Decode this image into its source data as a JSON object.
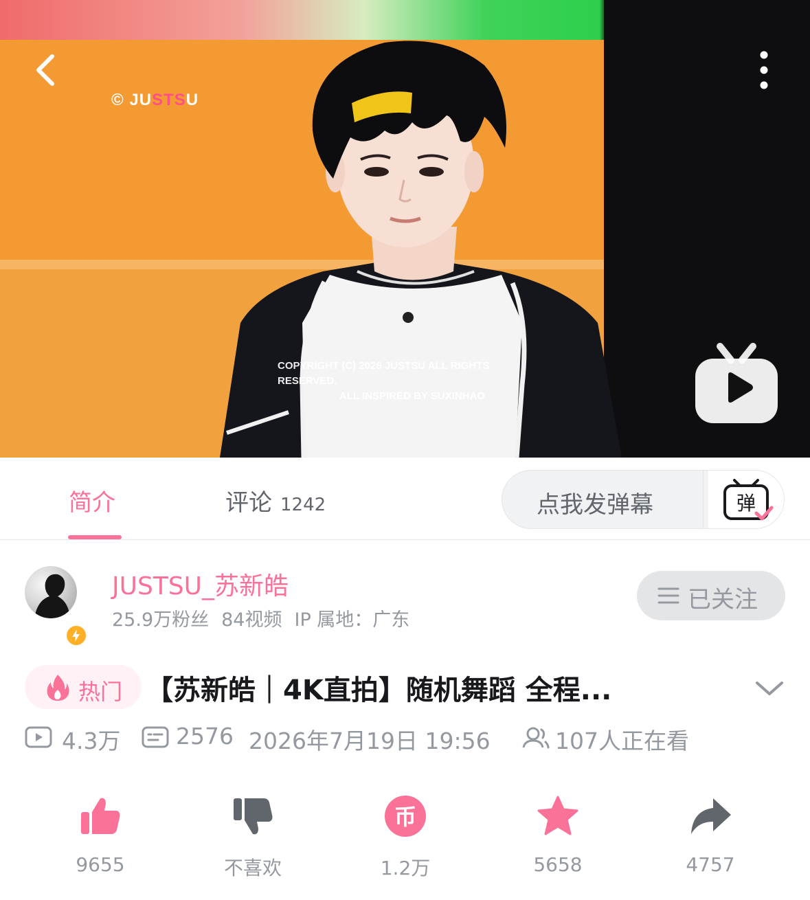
{
  "player": {
    "watermark_logo_prefix": "© JU",
    "watermark_logo_highlight": "STS",
    "watermark_logo_suffix": "U",
    "watermark_copyright_line1": "COPYRIGHT (C) 2026 JUSTSU ALL RIGHTS RESERVED.",
    "watermark_copyright_line2": "ALL INSPIRED BY SUXINHAO",
    "icons": {
      "back": "chevron-left-icon",
      "more": "more-vertical-icon",
      "play": "tv-play-icon"
    }
  },
  "tabs": {
    "intro_label": "简介",
    "comments_label": "评论",
    "comments_count": "1242"
  },
  "danmaku": {
    "placeholder": "点我发弹幕",
    "toggle_glyph": "弹"
  },
  "uploader": {
    "name": "JUSTSU_苏新皓",
    "fans": "25.9万粉丝",
    "videos": "84视频",
    "ip": "IP 属地：广东",
    "follow_label": "已关注"
  },
  "video": {
    "hot_label": "热门",
    "title": "【苏新皓｜4K直拍】随机舞蹈 全程...",
    "views": "4.3万",
    "danmaku_count": "2576",
    "publish_time": "2026年7月19日 19:56",
    "watching": "107人正在看"
  },
  "actions": {
    "like_count": "9655",
    "dislike_label": "不喜欢",
    "coin_count": "1.2万",
    "coin_glyph": "币",
    "favorite_count": "5658",
    "share_count": "4757"
  },
  "colors": {
    "accent": "#fb7299",
    "text_primary": "#18191c",
    "text_secondary": "#9499a0",
    "stage_orange": "#f39a32"
  }
}
